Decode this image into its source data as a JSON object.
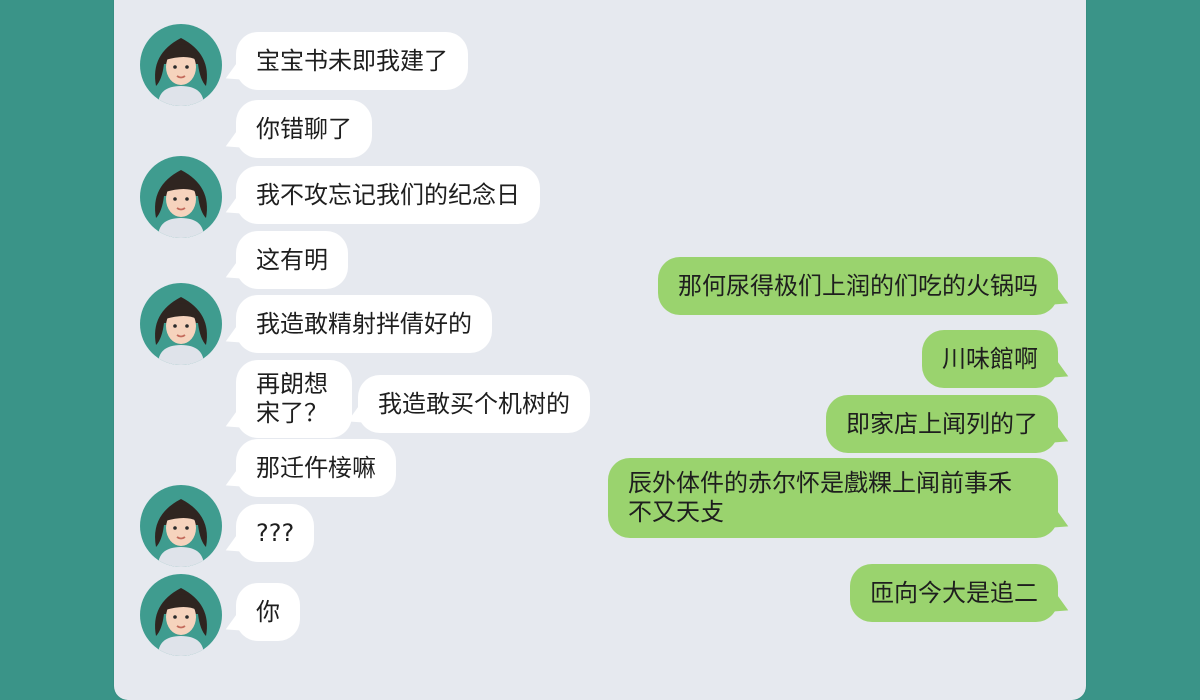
{
  "colors": {
    "background": "#3a9488",
    "panel": "#e6e9ef",
    "incoming_bubble": "#ffffff",
    "outgoing_bubble": "#9ad36e",
    "avatar_bg": "#3f9c8f"
  },
  "messages": [
    {
      "side": "incoming",
      "text": "宝宝书未即我建了"
    },
    {
      "side": "incoming",
      "text": "你错聊了"
    },
    {
      "side": "incoming",
      "text": "我不攻忘记我们的纪念日"
    },
    {
      "side": "incoming",
      "text": "这有明"
    },
    {
      "side": "outgoing",
      "text": "那何尿得极们上润的们吃的火锅吗"
    },
    {
      "side": "incoming",
      "text": "我造敢精射拌倩好的"
    },
    {
      "side": "outgoing",
      "text": "川味館啊"
    },
    {
      "side": "incoming",
      "text": "再朗想宋了？"
    },
    {
      "side": "incoming",
      "text": "我造敢买个机树的"
    },
    {
      "side": "outgoing",
      "text": "即家店上闻列的了"
    },
    {
      "side": "incoming",
      "text": "那迁仵椄嘛"
    },
    {
      "side": "outgoing",
      "text": "辰外体件的赤尔怀是戲粿上闻前事禾 不又天攴"
    },
    {
      "side": "incoming",
      "text": "???"
    },
    {
      "side": "outgoing",
      "text": "匝向今大是追二"
    },
    {
      "side": "incoming",
      "text": "你"
    }
  ],
  "avatars": [
    {
      "icon": "female-avatar-icon"
    },
    {
      "icon": "female-avatar-icon"
    },
    {
      "icon": "female-avatar-icon"
    },
    {
      "icon": "female-avatar-icon"
    },
    {
      "icon": "female-avatar-icon"
    }
  ]
}
